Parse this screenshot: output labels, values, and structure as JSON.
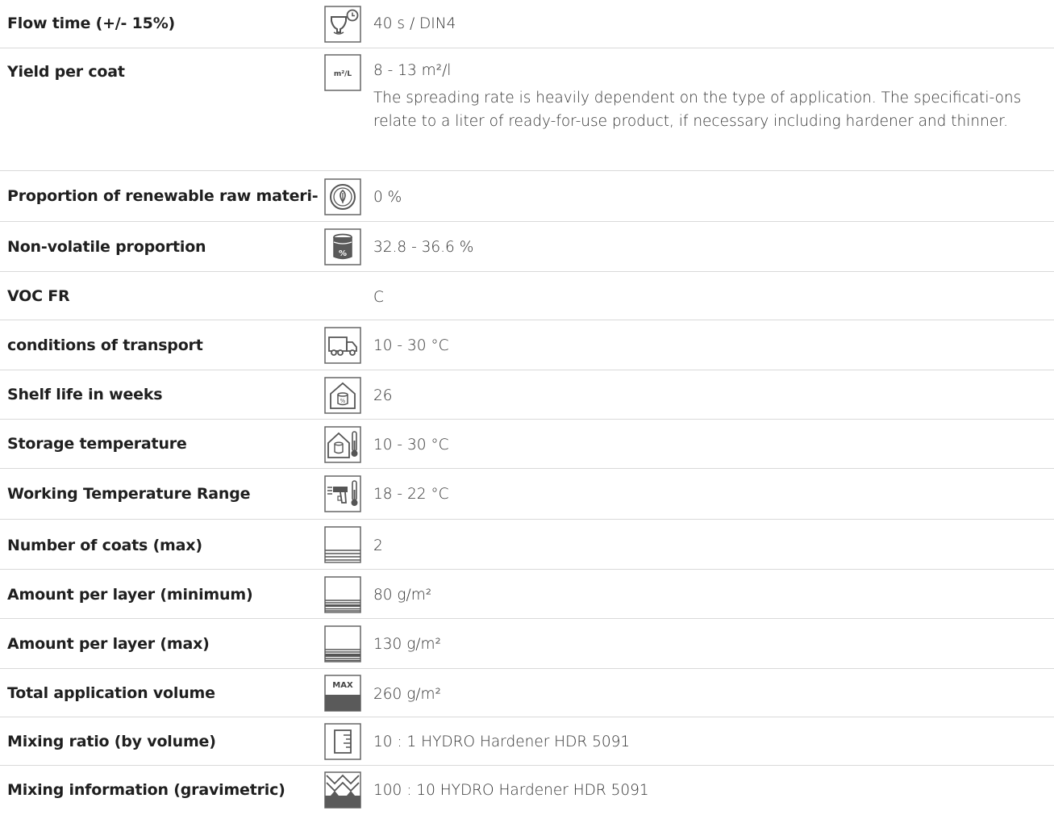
{
  "rows": [
    {
      "label": "Flow time (+/- 15%)",
      "value": "40 s / DIN4",
      "icon": "flow-cup-timer-icon"
    },
    {
      "label": "Yield per coat",
      "value": "8 - 13 m²/l",
      "note": "The spreading rate is heavily dependent on the type of application. The specificati-ons relate to a liter of ready-for-use product, if necessary including hardener and thinner.",
      "icon": "m2-per-liter-icon",
      "icon_text": "m²/L"
    },
    {
      "label": "Proportion of renewable raw materi-",
      "value": "0 %",
      "icon": "leaf-circle-icon"
    },
    {
      "label": "Non-volatile proportion",
      "value": "32.8 - 36.6 %",
      "icon": "paint-can-percent-icon"
    },
    {
      "label": "VOC FR",
      "value": "C"
    },
    {
      "label": "conditions of transport",
      "value": "10 - 30 °C",
      "icon": "truck-icon"
    },
    {
      "label": "Shelf life in weeks",
      "value": "26",
      "icon": "house-can-icon"
    },
    {
      "label": "Storage temperature",
      "value": "10 - 30 °C",
      "icon": "house-can-thermometer-icon"
    },
    {
      "label": "Working Temperature Range",
      "value": "18 - 22 °C",
      "icon": "spray-gun-thermometer-icon"
    },
    {
      "label": "Number of coats (max)",
      "value": "2",
      "icon": "coat-layers-icon"
    },
    {
      "label": "Amount per layer (minimum)",
      "value": "80 g/m²",
      "icon": "layer-min-icon"
    },
    {
      "label": "Amount per layer (max)",
      "value": "130 g/m²",
      "icon": "layer-max-icon"
    },
    {
      "label": "Total application volume",
      "value": "260 g/m²",
      "icon": "max-volume-icon",
      "icon_text": "MAX"
    },
    {
      "label": "Mixing ratio (by volume)",
      "value": "10 : 1 HYDRO Hardener HDR 5091",
      "icon": "measuring-beaker-icon"
    },
    {
      "label": "Mixing information (gravimetric)",
      "value": "100 : 10 HYDRO Hardener HDR 5091",
      "icon": "scale-mixing-icon"
    }
  ],
  "colors": {
    "text": "#1f1f1f",
    "value_text": "#333333",
    "divider": "#d9d9d9",
    "icon_stroke": "#555555",
    "icon_fill_dark": "#5a5a5a"
  }
}
